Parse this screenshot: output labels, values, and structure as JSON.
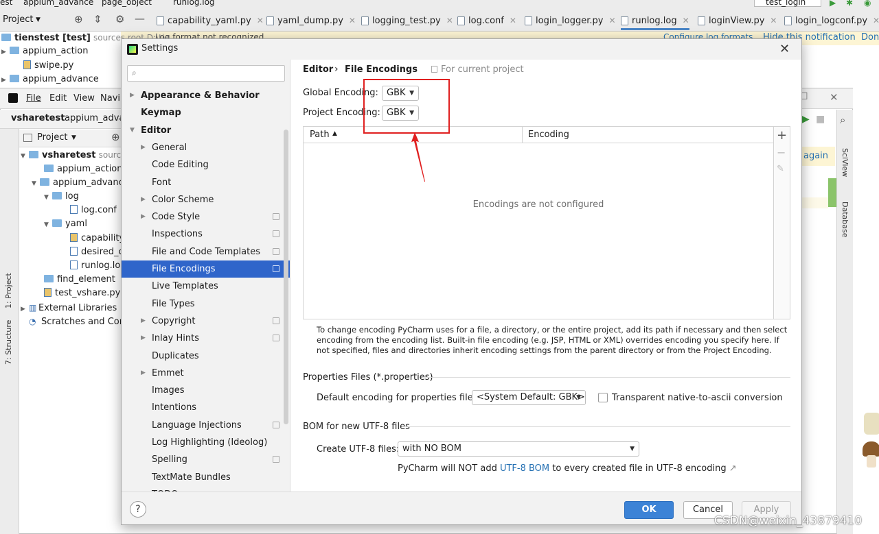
{
  "background_ide": {
    "top_breadcrumbs": [
      "est",
      "appium_advance",
      "page_object",
      "runlog.log"
    ],
    "run_config": "test_login",
    "project_label": "Project",
    "tabs": [
      {
        "label": "capability_yaml.py",
        "active": false
      },
      {
        "label": "yaml_dump.py",
        "active": false
      },
      {
        "label": "logging_test.py",
        "active": false
      },
      {
        "label": "log.conf",
        "active": false
      },
      {
        "label": "login_logger.py",
        "active": false
      },
      {
        "label": "runlog.log",
        "active": true
      },
      {
        "label": "loginView.py",
        "active": false
      },
      {
        "label": "login_logconf.py",
        "active": false
      }
    ],
    "notification": {
      "text": "Log format not recognized",
      "configure": "Configure log formats",
      "hide": "Hide this notification",
      "dont": "Don't"
    },
    "outer_tree": [
      {
        "name": "tienstest [test]",
        "suffix": "sources root  D:\\tie",
        "kind": "folder"
      },
      {
        "name": "appium_action",
        "kind": "folder"
      },
      {
        "name": "swipe.py",
        "kind": "py"
      },
      {
        "name": "appium_advance",
        "kind": "folder"
      }
    ],
    "inner_menu": [
      "File",
      "Edit",
      "View",
      "Navi"
    ],
    "inner_crumbs": [
      "vsharetest",
      "appium_advan"
    ],
    "inner_project_label": "Project",
    "inner_tree": [
      {
        "name": "vsharetest",
        "suffix": "sources",
        "kind": "folder"
      },
      {
        "name": "appium_action",
        "kind": "folder"
      },
      {
        "name": "appium_advanc",
        "kind": "folder"
      },
      {
        "name": "log",
        "kind": "folder"
      },
      {
        "name": "log.conf",
        "kind": "log"
      },
      {
        "name": "yaml",
        "kind": "folder"
      },
      {
        "name": "capability",
        "kind": "py"
      },
      {
        "name": "desired_c",
        "kind": "log"
      },
      {
        "name": "runlog.log",
        "kind": "log"
      },
      {
        "name": "find_element",
        "kind": "folder"
      },
      {
        "name": "test_vshare.py",
        "kind": "py"
      },
      {
        "name": "External Libraries",
        "kind": "lib"
      },
      {
        "name": "Scratches and Cons",
        "kind": "lib"
      }
    ],
    "left_tools": [
      "1: Project",
      "7: Structure"
    ],
    "right_tools": [
      "SciView",
      "Database"
    ],
    "right_snippet": "again"
  },
  "dialog": {
    "title": "Settings",
    "close_glyph": "✕",
    "search": {
      "placeholder": "",
      "value": ""
    },
    "nav": [
      {
        "label": "Appearance & Behavior",
        "level": 0,
        "expander": "right",
        "bold": true,
        "copy": false,
        "selected": false
      },
      {
        "label": "Keymap",
        "level": 0,
        "expander": "none",
        "bold": true,
        "copy": false,
        "selected": false
      },
      {
        "label": "Editor",
        "level": 0,
        "expander": "down",
        "bold": true,
        "copy": false,
        "selected": false
      },
      {
        "label": "General",
        "level": 1,
        "expander": "right",
        "bold": false,
        "copy": false,
        "selected": false
      },
      {
        "label": "Code Editing",
        "level": 1,
        "expander": "none",
        "bold": false,
        "copy": false,
        "selected": false
      },
      {
        "label": "Font",
        "level": 1,
        "expander": "none",
        "bold": false,
        "copy": false,
        "selected": false
      },
      {
        "label": "Color Scheme",
        "level": 1,
        "expander": "right",
        "bold": false,
        "copy": false,
        "selected": false
      },
      {
        "label": "Code Style",
        "level": 1,
        "expander": "right",
        "bold": false,
        "copy": true,
        "selected": false
      },
      {
        "label": "Inspections",
        "level": 1,
        "expander": "none",
        "bold": false,
        "copy": true,
        "selected": false
      },
      {
        "label": "File and Code Templates",
        "level": 1,
        "expander": "none",
        "bold": false,
        "copy": true,
        "selected": false
      },
      {
        "label": "File Encodings",
        "level": 1,
        "expander": "none",
        "bold": false,
        "copy": true,
        "selected": true
      },
      {
        "label": "Live Templates",
        "level": 1,
        "expander": "none",
        "bold": false,
        "copy": false,
        "selected": false
      },
      {
        "label": "File Types",
        "level": 1,
        "expander": "none",
        "bold": false,
        "copy": false,
        "selected": false
      },
      {
        "label": "Copyright",
        "level": 1,
        "expander": "right",
        "bold": false,
        "copy": true,
        "selected": false
      },
      {
        "label": "Inlay Hints",
        "level": 1,
        "expander": "right",
        "bold": false,
        "copy": true,
        "selected": false
      },
      {
        "label": "Duplicates",
        "level": 1,
        "expander": "none",
        "bold": false,
        "copy": false,
        "selected": false
      },
      {
        "label": "Emmet",
        "level": 1,
        "expander": "right",
        "bold": false,
        "copy": false,
        "selected": false
      },
      {
        "label": "Images",
        "level": 1,
        "expander": "none",
        "bold": false,
        "copy": false,
        "selected": false
      },
      {
        "label": "Intentions",
        "level": 1,
        "expander": "none",
        "bold": false,
        "copy": false,
        "selected": false
      },
      {
        "label": "Language Injections",
        "level": 1,
        "expander": "none",
        "bold": false,
        "copy": true,
        "selected": false
      },
      {
        "label": "Log Highlighting (Ideolog)",
        "level": 1,
        "expander": "none",
        "bold": false,
        "copy": false,
        "selected": false
      },
      {
        "label": "Spelling",
        "level": 1,
        "expander": "none",
        "bold": false,
        "copy": true,
        "selected": false
      },
      {
        "label": "TextMate Bundles",
        "level": 1,
        "expander": "none",
        "bold": false,
        "copy": false,
        "selected": false
      },
      {
        "label": "TODO",
        "level": 1,
        "expander": "none",
        "bold": false,
        "copy": false,
        "selected": false
      }
    ],
    "breadcrumb": {
      "parent": "Editor",
      "separator": "›",
      "current": "File Encodings",
      "scope": "For current project"
    },
    "global_encoding": {
      "label": "Global Encoding:",
      "value": "GBK"
    },
    "project_encoding": {
      "label": "Project Encoding:",
      "value": "GBK"
    },
    "table": {
      "columns": [
        "Path",
        "Encoding"
      ],
      "sort_glyph": "▲",
      "empty_message": "Encodings are not configured",
      "add_glyph": "+",
      "remove_glyph": "−",
      "edit_glyph": "✎"
    },
    "help_text": "To change encoding PyCharm uses for a file, a directory, or the entire project, add its path if necessary and then select encoding from the encoding list. Built-in file encoding (e.g. JSP, HTML or XML) overrides encoding you specify here. If not specified, files and directories inherit encoding settings from the parent directory or from the Project Encoding.",
    "properties": {
      "section_title": "Properties Files (*.properties)",
      "default_label": "Default encoding for properties files:",
      "default_value": "<System Default: GBK>",
      "transparent_label": "Transparent native-to-ascii conversion",
      "transparent_checked": false
    },
    "bom": {
      "section_title": "BOM for new UTF-8 files",
      "create_label": "Create UTF-8 files:",
      "create_value": "with NO BOM",
      "note_prefix": "PyCharm will NOT add ",
      "note_link": "UTF-8 BOM",
      "note_suffix": " to every created file in UTF-8 encoding",
      "note_arrow": "↗"
    },
    "buttons": {
      "help": "?",
      "ok": "OK",
      "cancel": "Cancel",
      "apply": "Apply",
      "apply_enabled": false
    }
  },
  "watermark": "CSDN@weixin_43879410",
  "colors": {
    "selection": "#2f65ca",
    "ok_button": "#3c83d6",
    "link": "#2470b3",
    "annotation": "#e02020",
    "notification_bar": "#fdf5d4"
  }
}
